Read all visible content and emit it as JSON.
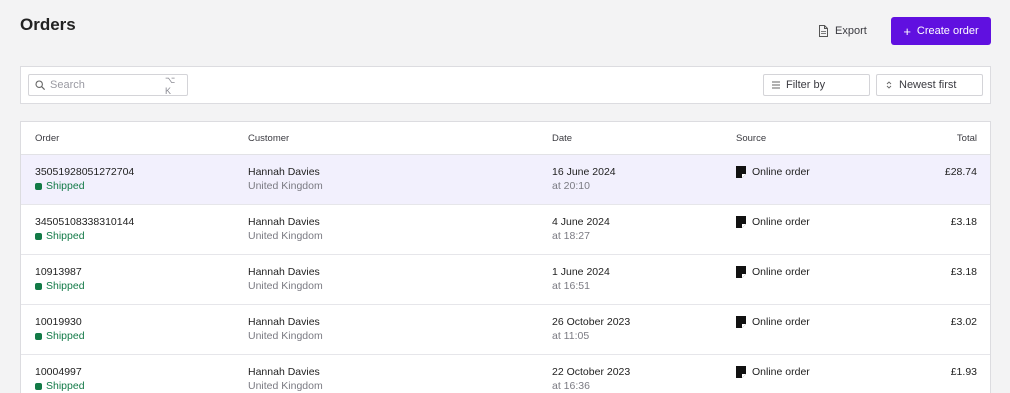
{
  "header": {
    "title": "Orders",
    "export_label": "Export",
    "create_label": "Create order"
  },
  "toolbar": {
    "search_placeholder": "Search",
    "search_shortcut": "⌥ K",
    "filter_label": "Filter by",
    "sort_label": "Newest first"
  },
  "table": {
    "columns": {
      "order": "Order",
      "customer": "Customer",
      "date": "Date",
      "source": "Source",
      "total": "Total"
    },
    "rows": [
      {
        "order": "35051928051272704",
        "status": "Shipped",
        "customer": "Hannah Davies",
        "country": "United Kingdom",
        "date": "16 June 2024",
        "time": "at 20:10",
        "source": "Online order",
        "total": "£28.74",
        "selected": true
      },
      {
        "order": "34505108338310144",
        "status": "Shipped",
        "customer": "Hannah Davies",
        "country": "United Kingdom",
        "date": "4 June 2024",
        "time": "at 18:27",
        "source": "Online order",
        "total": "£3.18"
      },
      {
        "order": "10913987",
        "status": "Shipped",
        "customer": "Hannah Davies",
        "country": "United Kingdom",
        "date": "1 June 2024",
        "time": "at 16:51",
        "source": "Online order",
        "total": "£3.18"
      },
      {
        "order": "10019930",
        "status": "Shipped",
        "customer": "Hannah Davies",
        "country": "United Kingdom",
        "date": "26 October 2023",
        "time": "at 11:05",
        "source": "Online order",
        "total": "£3.02"
      },
      {
        "order": "10004997",
        "status": "Shipped",
        "customer": "Hannah Davies",
        "country": "United Kingdom",
        "date": "22 October 2023",
        "time": "at 16:36",
        "source": "Online order",
        "total": "£1.93"
      }
    ]
  },
  "colors": {
    "accent": "#6010e0",
    "status_shipped": "#127a46",
    "selected_row": "#f2f0fd"
  },
  "icons": {
    "export": "document-icon",
    "create": "plus-icon",
    "search": "search-icon",
    "filter": "filter-lines-icon",
    "sort": "sort-arrows-icon",
    "source": "receipt-icon"
  }
}
